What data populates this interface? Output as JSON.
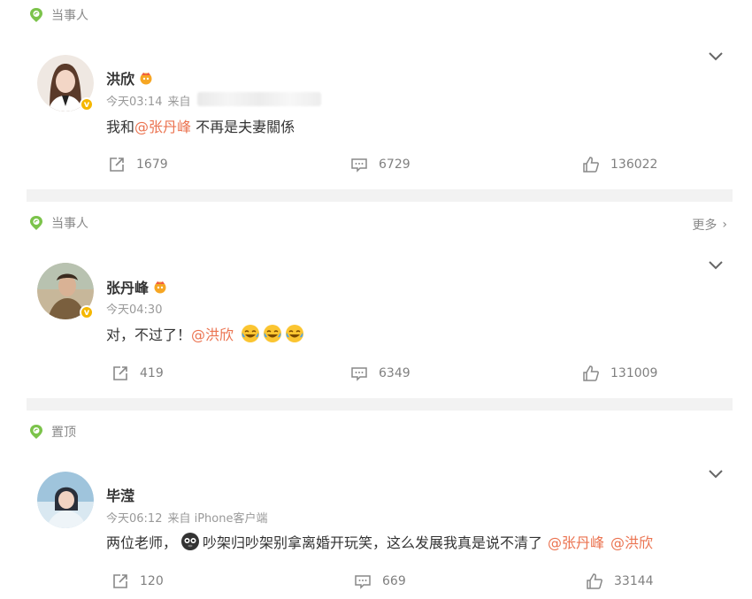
{
  "posts": [
    {
      "tag": "当事人",
      "more": "",
      "author": "洪欣",
      "time": "今天03:14",
      "source_prefix": "来自",
      "text_before": "我和",
      "mention1": "@张丹峰",
      "text_after": " 不再是夫妻關係",
      "reposts": "1679",
      "comments": "6729",
      "likes": "136022"
    },
    {
      "tag": "当事人",
      "more": "更多",
      "author": "张丹峰",
      "time": "今天04:30",
      "text_before": "对，不过了！",
      "mention1": "@洪欣",
      "reposts": "419",
      "comments": "6349",
      "likes": "131009"
    },
    {
      "tag": "置顶",
      "author": "毕滢",
      "time": "今天06:12",
      "source": "来自 iPhone客户端",
      "text_before": "两位老师，",
      "text_mid": "吵架归吵架别拿离婚开玩笑，这么发展我真是说不清了",
      "mention1": "@张丹峰",
      "mention2": "@洪欣",
      "reposts": "120",
      "comments": "669",
      "likes": "33144"
    }
  ],
  "colors": {
    "mention": "#eb7350",
    "tag_icon": "#7bc34a",
    "badge": "#f5b700",
    "divider": "#f2f2f2"
  }
}
